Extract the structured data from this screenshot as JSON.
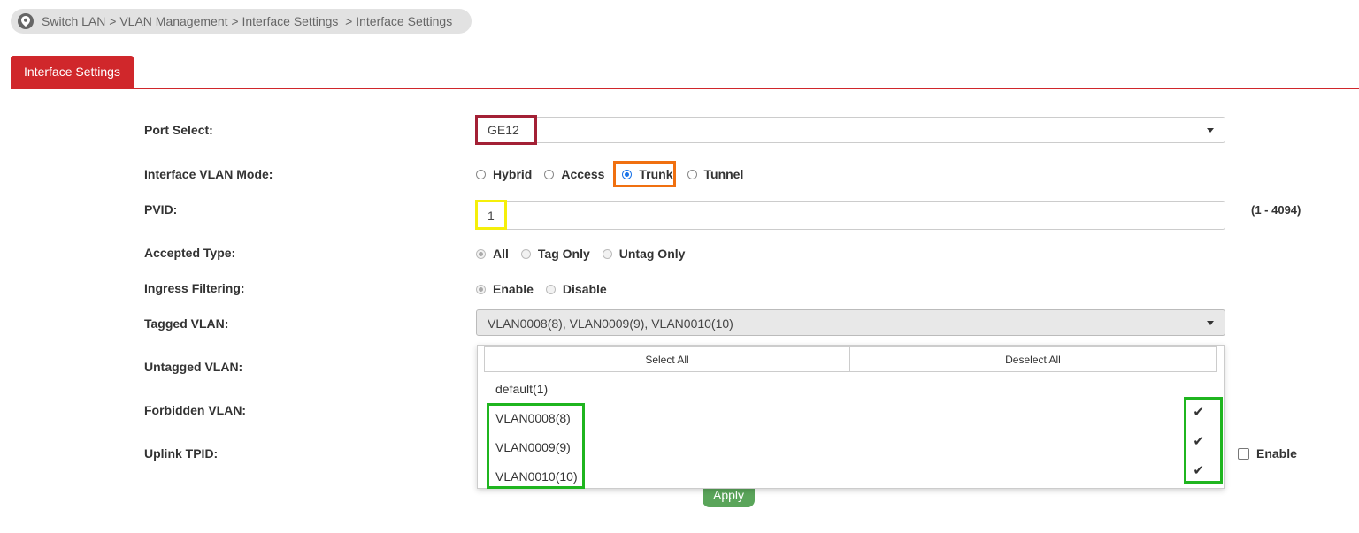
{
  "breadcrumb": {
    "text": "Switch LAN > VLAN Management > Interface Settings  > Interface Settings"
  },
  "tab": {
    "label": "Interface Settings"
  },
  "form": {
    "port_select": {
      "label": "Port Select:",
      "value": "GE12"
    },
    "vlan_mode": {
      "label": "Interface VLAN Mode:",
      "options": [
        "Hybrid",
        "Access",
        "Trunk",
        "Tunnel"
      ],
      "selected": "Trunk"
    },
    "pvid": {
      "label": "PVID:",
      "value": "1",
      "range": "(1 - 4094)"
    },
    "accepted_type": {
      "label": "Accepted Type:",
      "options": [
        "All",
        "Tag Only",
        "Untag Only"
      ],
      "selected": "All"
    },
    "ingress_filtering": {
      "label": "Ingress Filtering:",
      "options": [
        "Enable",
        "Disable"
      ],
      "selected": "Enable"
    },
    "tagged_vlan": {
      "label": "Tagged VLAN:",
      "value": "VLAN0008(8), VLAN0009(9), VLAN0010(10)"
    },
    "untagged_vlan": {
      "label": "Untagged VLAN:"
    },
    "forbidden_vlan": {
      "label": "Forbidden VLAN:"
    },
    "uplink_tpid": {
      "label": "Uplink TPID:",
      "enable_label": "Enable"
    }
  },
  "dropdown": {
    "select_all": "Select All",
    "deselect_all": "Deselect All",
    "items": [
      "default(1)",
      "VLAN0008(8)",
      "VLAN0009(9)",
      "VLAN0010(10)"
    ],
    "check_glyph": "✔"
  },
  "apply_label": "Apply",
  "colors": {
    "brand_red": "#d0272b",
    "highlight_port": "#a32035",
    "highlight_trunk": "#f07010",
    "highlight_pvid": "#f5ef0a",
    "highlight_vlans": "#1fb51f",
    "apply_green": "#5aa55a"
  }
}
